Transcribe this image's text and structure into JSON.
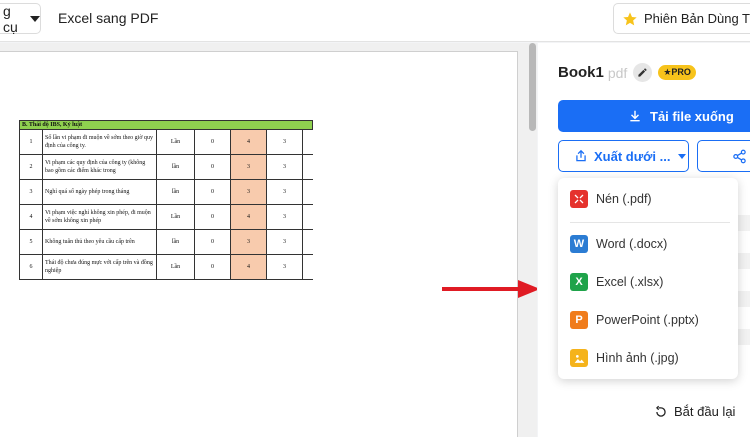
{
  "topbar": {
    "tools_label": "g cụ",
    "doc_title": "Excel sang PDF",
    "edition_label": "Phiên Bản Dùng Thử"
  },
  "sheet": {
    "section_title": "B. Thái độ IBS, Kỷ luật",
    "rows": [
      {
        "no": "1",
        "desc": "Số lần vi phạm đi muộn về sớm theo giờ quy định của công ty.",
        "unit": "Lần",
        "a": "0",
        "b": "4",
        "c": "3"
      },
      {
        "no": "2",
        "desc": "Vi phạm các quy định của công ty (không bao gồm các điểm khác trong",
        "unit": "lần",
        "a": "0",
        "b": "3",
        "c": "3"
      },
      {
        "no": "3",
        "desc": "Nghỉ quá số ngày phép trong tháng",
        "unit": "lần",
        "a": "0",
        "b": "3",
        "c": "3"
      },
      {
        "no": "4",
        "desc": "Vi phạm việc nghỉ không xin phép, đi muộn về sớm không xin phép",
        "unit": "Lần",
        "a": "0",
        "b": "4",
        "c": "3"
      },
      {
        "no": "5",
        "desc": "Không tuân thủ theo yêu cầu cấp trên",
        "unit": "lần",
        "a": "0",
        "b": "3",
        "c": "3"
      },
      {
        "no": "6",
        "desc": "Thái độ chưa đúng mực với cấp trên và đồng nghiệp",
        "unit": "Lần",
        "a": "0",
        "b": "4",
        "c": "3"
      }
    ]
  },
  "panel": {
    "file_name": "Book1",
    "file_ext": "pdf",
    "pro_badge": "★PRO",
    "download_label": "Tải file xuống",
    "export_label": "Xuất dưới ...",
    "restart_label": "Bắt đầu lại"
  },
  "export_menu": [
    {
      "label": "Nén (.pdf)",
      "icon": "compress-icon",
      "color": "#e5322d"
    },
    {
      "label": "Word (.docx)",
      "icon": "word-icon",
      "color": "#2b7cd3"
    },
    {
      "label": "Excel (.xlsx)",
      "icon": "excel-icon",
      "color": "#1fa34a"
    },
    {
      "label": "PowerPoint (.pptx)",
      "icon": "powerpoint-icon",
      "color": "#f07c1b"
    },
    {
      "label": "Hình ảnh (.jpg)",
      "icon": "image-icon",
      "color": "#f5b31b"
    }
  ],
  "colors": {
    "accent": "#1a6ef5",
    "arrow": "#e01b24",
    "header_green": "#8fd14f",
    "highlight_cell": "#f8cbad",
    "star": "#f7c31b"
  }
}
